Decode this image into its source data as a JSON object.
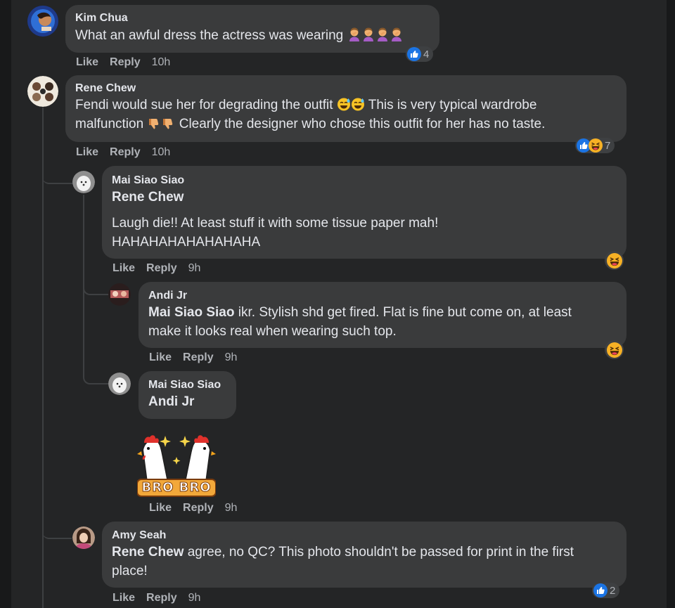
{
  "comments": [
    {
      "author": "Kim Chua",
      "text": "What an awful dress the actress was wearing",
      "actions": {
        "like": "Like",
        "reply": "Reply",
        "time": "10h"
      },
      "reactions": {
        "count": "4",
        "icons": [
          "like-icon"
        ]
      }
    },
    {
      "author": "Rene Chew",
      "text_part1": "Fendi would sue her for degrading the outfit",
      "text_part2": "This is very typical wardrobe",
      "text_part3": "malfunction",
      "text_part4": "Clearly the designer who chose this outfit for her has no taste.",
      "actions": {
        "like": "Like",
        "reply": "Reply",
        "time": "10h"
      },
      "reactions": {
        "count": "7",
        "icons": [
          "like-icon",
          "laugh-icon"
        ]
      }
    }
  ],
  "replies": [
    {
      "author": "Mai Siao Siao",
      "mention": "Rene Chew",
      "text_line1": "Laugh die!! At least stuff it with some tissue paper mah!",
      "text_line2": "HAHAHAHAHAHAHAHA",
      "actions": {
        "like": "Like",
        "reply": "Reply",
        "time": "9h"
      },
      "reactions": {
        "icons": [
          "laugh-icon"
        ]
      }
    },
    {
      "author": "Andi Jr",
      "mention": "Mai Siao Siao",
      "text_line1": "ikr. Stylish shd get fired. Flat is fine but come on, at least",
      "text_line2": "make it looks real when wearing such top.",
      "actions": {
        "like": "Like",
        "reply": "Reply",
        "time": "9h"
      },
      "reactions": {
        "icons": [
          "laugh-icon"
        ]
      }
    },
    {
      "author": "Mai Siao Siao",
      "mention": "Andi Jr",
      "sticker": {
        "text": "BRO BRO",
        "icon": "rooster-sticker-icon"
      },
      "actions": {
        "like": "Like",
        "reply": "Reply",
        "time": "9h"
      }
    },
    {
      "author": "Amy Seah",
      "mention": "Rene Chew",
      "text_line1": "agree, no QC? This photo shouldn't be passed for print in the first",
      "text_line2": "place!",
      "actions": {
        "like": "Like",
        "reply": "Reply",
        "time": "9h"
      },
      "reactions": {
        "count": "2",
        "icons": [
          "like-icon"
        ]
      }
    }
  ],
  "colors": {
    "background": "#242526",
    "bubble": "#3a3b3c",
    "text": "#e4e6eb",
    "muted": "#b0b3b8",
    "like_blue": "#1877f2"
  }
}
